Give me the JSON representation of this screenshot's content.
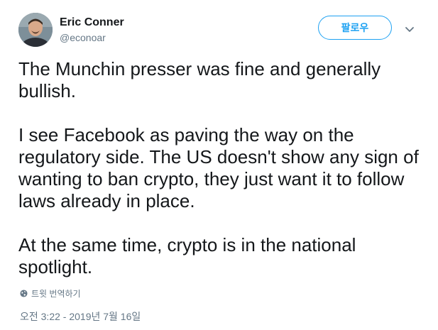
{
  "author": {
    "name": "Eric Conner",
    "handle": "@econoar",
    "avatar_icon": "user-avatar-icon"
  },
  "actions": {
    "follow_label": "팔로우",
    "menu_icon": "chevron-down-icon"
  },
  "tweet": {
    "paragraph_1": "The Munchin presser was fine and generally bullish.",
    "paragraph_2": "I see Facebook as paving the way on the regulatory side. The US doesn't show any sign of wanting to ban crypto, they just want it to follow laws already in place.",
    "paragraph_3": "At the same time, crypto is in the national spotlight."
  },
  "translate": {
    "label": "트윗 번역하기",
    "icon": "globe-icon"
  },
  "meta": {
    "timestamp": "오전 3:22 - 2019년 7월 16일"
  },
  "colors": {
    "accent": "#1da1f2",
    "text": "#14171a",
    "secondary": "#657786"
  }
}
